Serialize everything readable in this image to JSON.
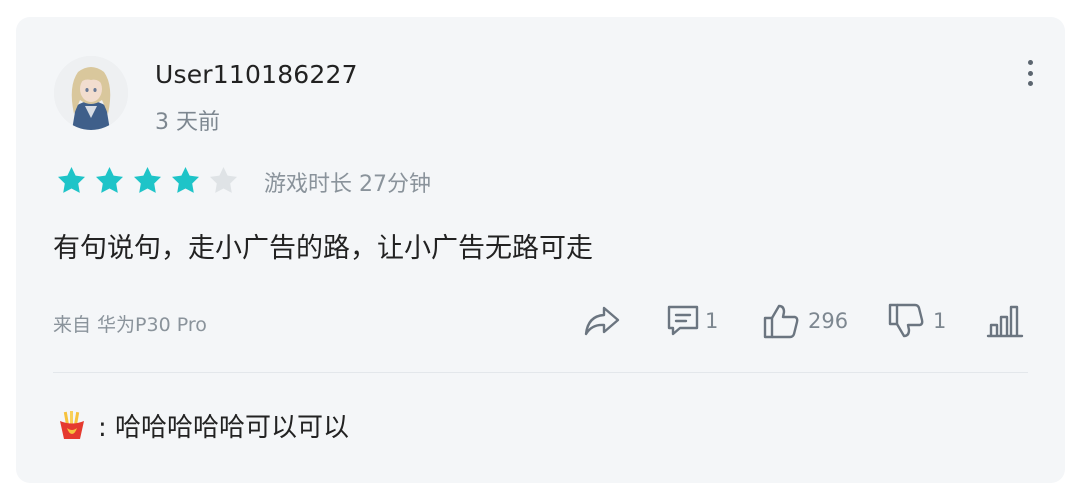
{
  "review": {
    "username": "User110186227",
    "time_ago": "3 天前",
    "rating": 4,
    "rating_max": 5,
    "star_color": "#1ec4c8",
    "star_empty_color": "#dfe3e6",
    "playtime": "游戏时长 27分钟",
    "content": "有句说句，走小广告的路，让小广告无路可走",
    "device": "来自 华为P30 Pro"
  },
  "actions": {
    "share_icon": "share-icon",
    "comment_icon": "comment-icon",
    "comment_count": "1",
    "like_icon": "thumbs-up-icon",
    "like_count": "296",
    "dislike_icon": "thumbs-down-icon",
    "dislike_count": "1",
    "stats_icon": "bar-chart-icon"
  },
  "reply": {
    "icon": "fries-icon",
    "text": ": 哈哈哈哈哈可以可以"
  }
}
